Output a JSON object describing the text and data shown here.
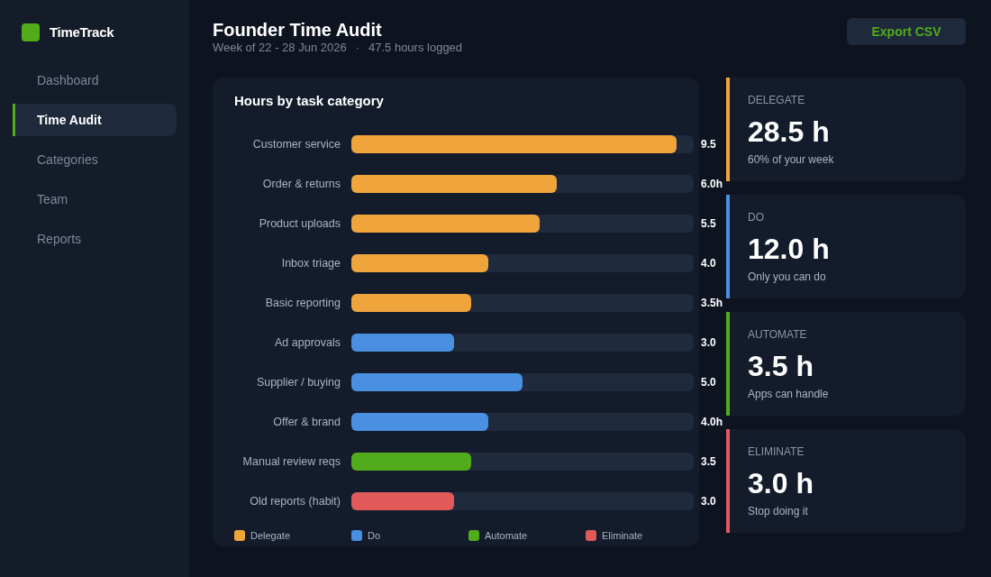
{
  "sidebar": {
    "brand": "TimeTrack",
    "items": [
      {
        "label": "Dashboard",
        "selected": false
      },
      {
        "label": "Time Audit",
        "selected": true
      },
      {
        "label": "Categories",
        "selected": false
      },
      {
        "label": "Team",
        "selected": false
      },
      {
        "label": "Reports",
        "selected": false
      }
    ]
  },
  "header": {
    "title": "Founder Time Audit",
    "week": "Week of 22 - 28 Jun 2026",
    "separator": "·",
    "total": "47.5 hours logged",
    "export_button": "Export CSV"
  },
  "chart": {
    "title": "Hours by task category",
    "rows": [
      {
        "label": "Customer service",
        "level": 0.95,
        "reading": "9.5",
        "color": "#f0a53c"
      },
      {
        "label": "Order & returns",
        "level": 0.6,
        "reading": "6.0h",
        "color": "#f0a53c"
      },
      {
        "label": "Product uploads",
        "level": 0.55,
        "reading": "5.5",
        "color": "#f0a53c"
      },
      {
        "label": "Inbox triage",
        "level": 0.4,
        "reading": "4.0",
        "color": "#f0a53c"
      },
      {
        "label": "Basic reporting",
        "level": 0.35,
        "reading": "3.5h",
        "color": "#f0a53c"
      },
      {
        "label": "Ad approvals",
        "level": 0.3,
        "reading": "3.0",
        "color": "#4a90e2"
      },
      {
        "label": "Supplier / buying",
        "level": 0.5,
        "reading": "5.0",
        "color": "#4a90e2"
      },
      {
        "label": "Offer & brand",
        "level": 0.4,
        "reading": "4.0h",
        "color": "#4a90e2"
      },
      {
        "label": "Manual review reqs",
        "level": 0.35,
        "reading": "3.5",
        "color": "#52ab1b"
      },
      {
        "label": "Old reports (habit)",
        "level": 0.3,
        "reading": "3.0",
        "color": "#e05a5a"
      }
    ],
    "legend": [
      {
        "label": "Delegate",
        "color": "#f0a53c"
      },
      {
        "label": "Do",
        "color": "#4a90e2"
      },
      {
        "label": "Automate",
        "color": "#52ab1b"
      },
      {
        "label": "Eliminate",
        "color": "#e05a5a"
      }
    ]
  },
  "summary_cards": [
    {
      "label": "DELEGATE",
      "value": "28.5 h",
      "note": "60% of your week",
      "color": "#f0a53c"
    },
    {
      "label": "DO",
      "value": "12.0 h",
      "note": "Only you can do",
      "color": "#4a90e2"
    },
    {
      "label": "AUTOMATE",
      "value": "3.5 h",
      "note": "Apps can handle",
      "color": "#52ab1b"
    },
    {
      "label": "ELIMINATE",
      "value": "3.0 h",
      "note": "Stop doing it",
      "color": "#e05a5a"
    }
  ]
}
